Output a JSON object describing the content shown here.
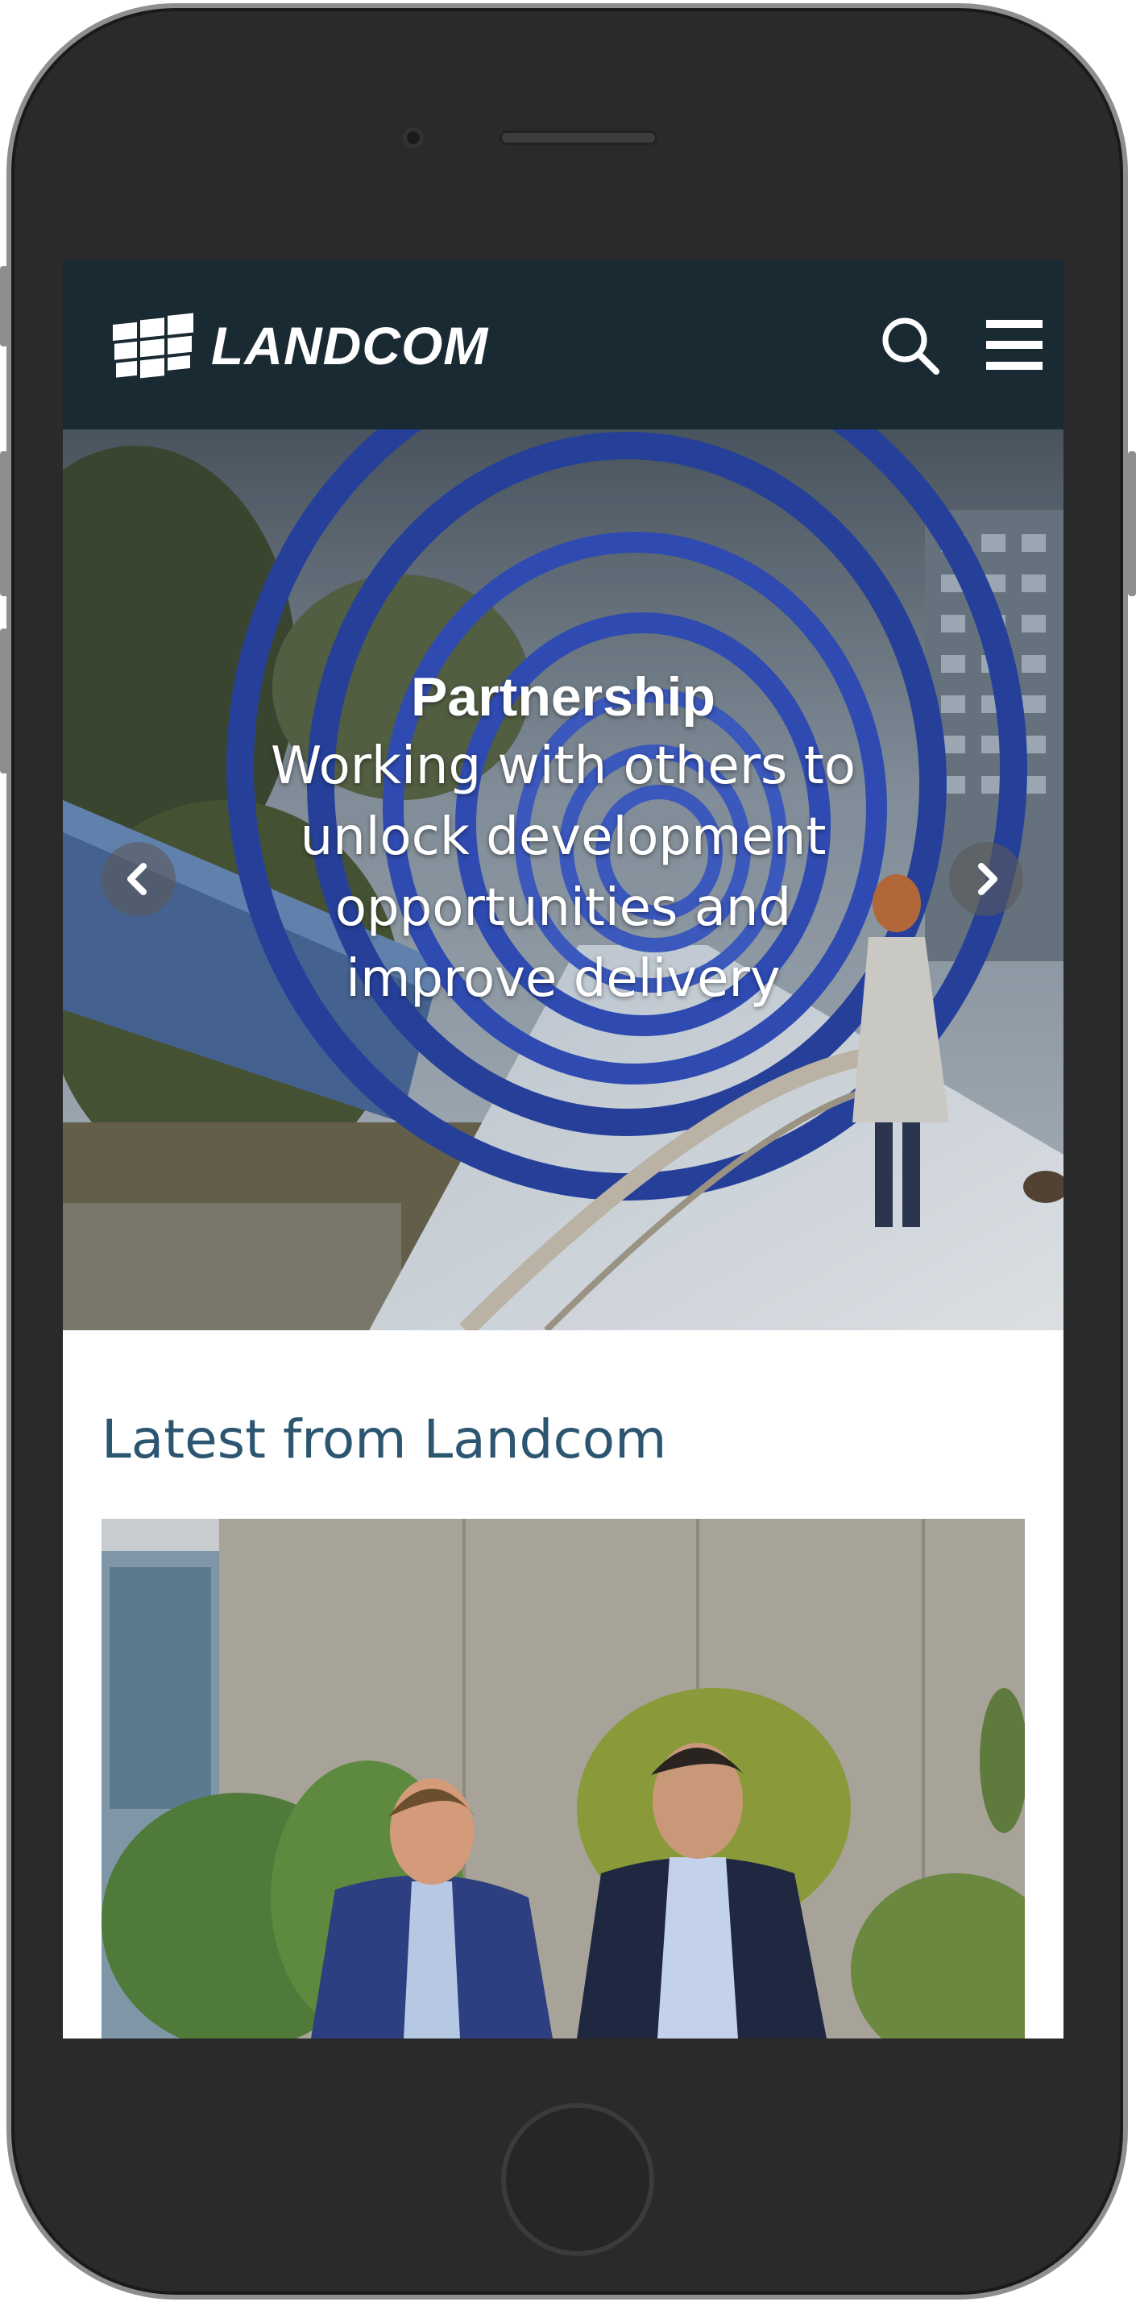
{
  "header": {
    "logo_text": "LANDCOM",
    "logo_icon": "landcom-window-logo",
    "search_icon": "search-icon",
    "menu_icon": "hamburger-menu-icon",
    "background_color": "#1a2a32"
  },
  "hero": {
    "title": "Partnership",
    "subtitle": "Working with others to unlock development opportunities and improve delivery",
    "prev_icon": "chevron-left-icon",
    "next_icon": "chevron-right-icon"
  },
  "latest": {
    "heading": "Latest from Landcom",
    "heading_color": "#2b5570"
  }
}
